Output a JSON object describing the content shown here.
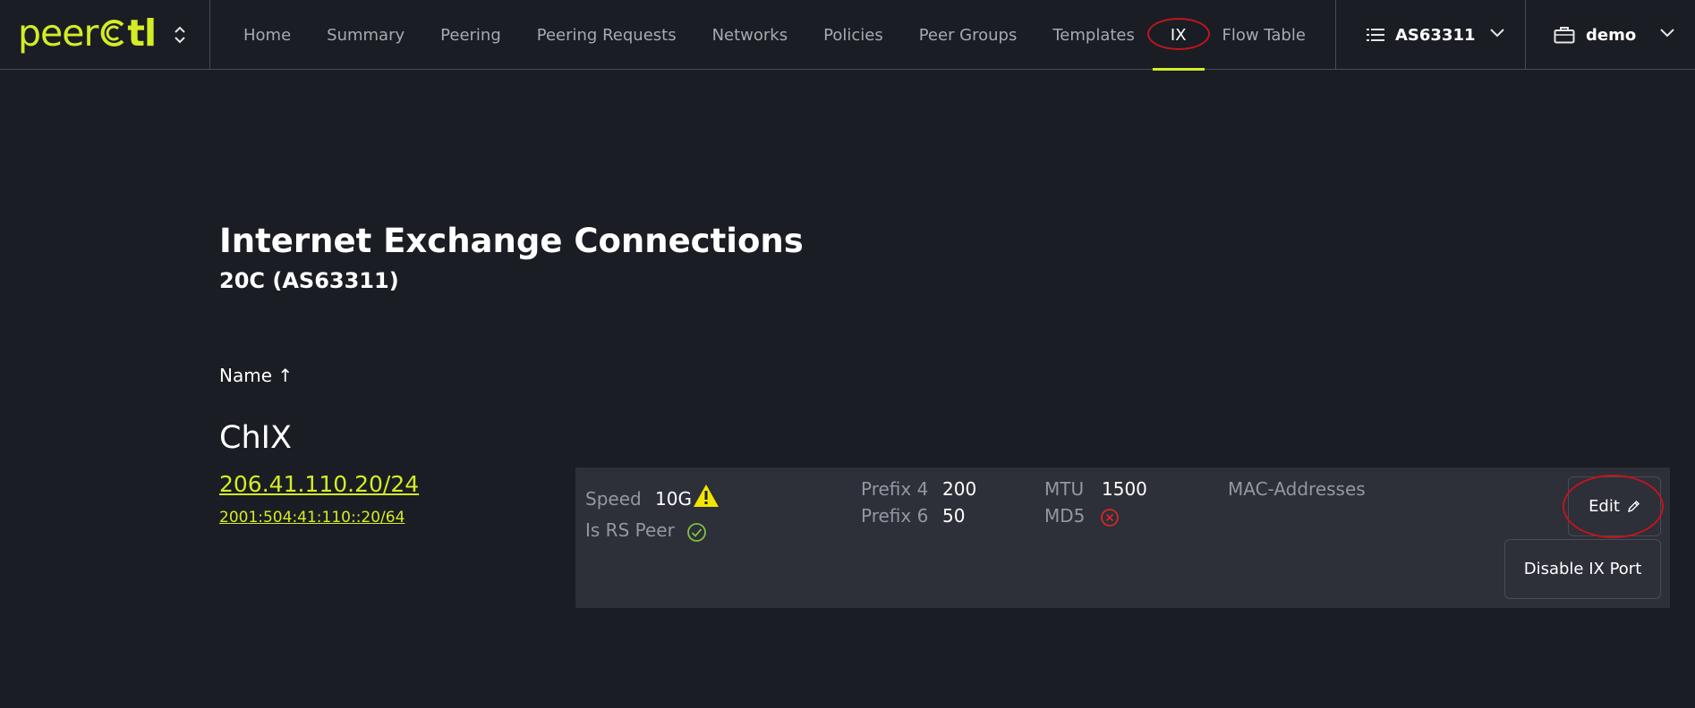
{
  "app": {
    "logo_text_light": "peer",
    "logo_text_bold": "tl",
    "accent_color": "#d4ec25",
    "highlight_color": "#c0151c"
  },
  "nav": {
    "items": [
      {
        "label": "Home",
        "active": false
      },
      {
        "label": "Summary",
        "active": false
      },
      {
        "label": "Peering",
        "active": false
      },
      {
        "label": "Peering Requests",
        "active": false
      },
      {
        "label": "Networks",
        "active": false
      },
      {
        "label": "Policies",
        "active": false
      },
      {
        "label": "Peer Groups",
        "active": false
      },
      {
        "label": "Templates",
        "active": false
      },
      {
        "label": "IX",
        "active": true
      },
      {
        "label": "Flow Table",
        "active": false
      }
    ]
  },
  "asn_selector": {
    "label": "AS63311",
    "icon": "list-icon"
  },
  "org_selector": {
    "label": "demo",
    "icon": "briefcase-icon"
  },
  "page": {
    "title": "Internet Exchange Connections",
    "subtitle": "20C (AS63311)",
    "sort_header": "Name ↑"
  },
  "ix": {
    "name": "ChIX",
    "ipv4": "206.41.110.20/24",
    "ipv6": "2001:504:41:110::20/64",
    "details": {
      "speed_label": "Speed",
      "speed_value": "10G",
      "speed_warning": true,
      "rs_peer_label": "Is RS Peer",
      "rs_peer_value": true,
      "prefix4_label": "Prefix 4",
      "prefix4_value": "200",
      "prefix6_label": "Prefix 6",
      "prefix6_value": "50",
      "mtu_label": "MTU",
      "mtu_value": "1500",
      "md5_label": "MD5",
      "md5_value": false,
      "mac_label": "MAC-Addresses"
    },
    "actions": {
      "edit_label": "Edit",
      "disable_label": "Disable IX Port"
    }
  }
}
